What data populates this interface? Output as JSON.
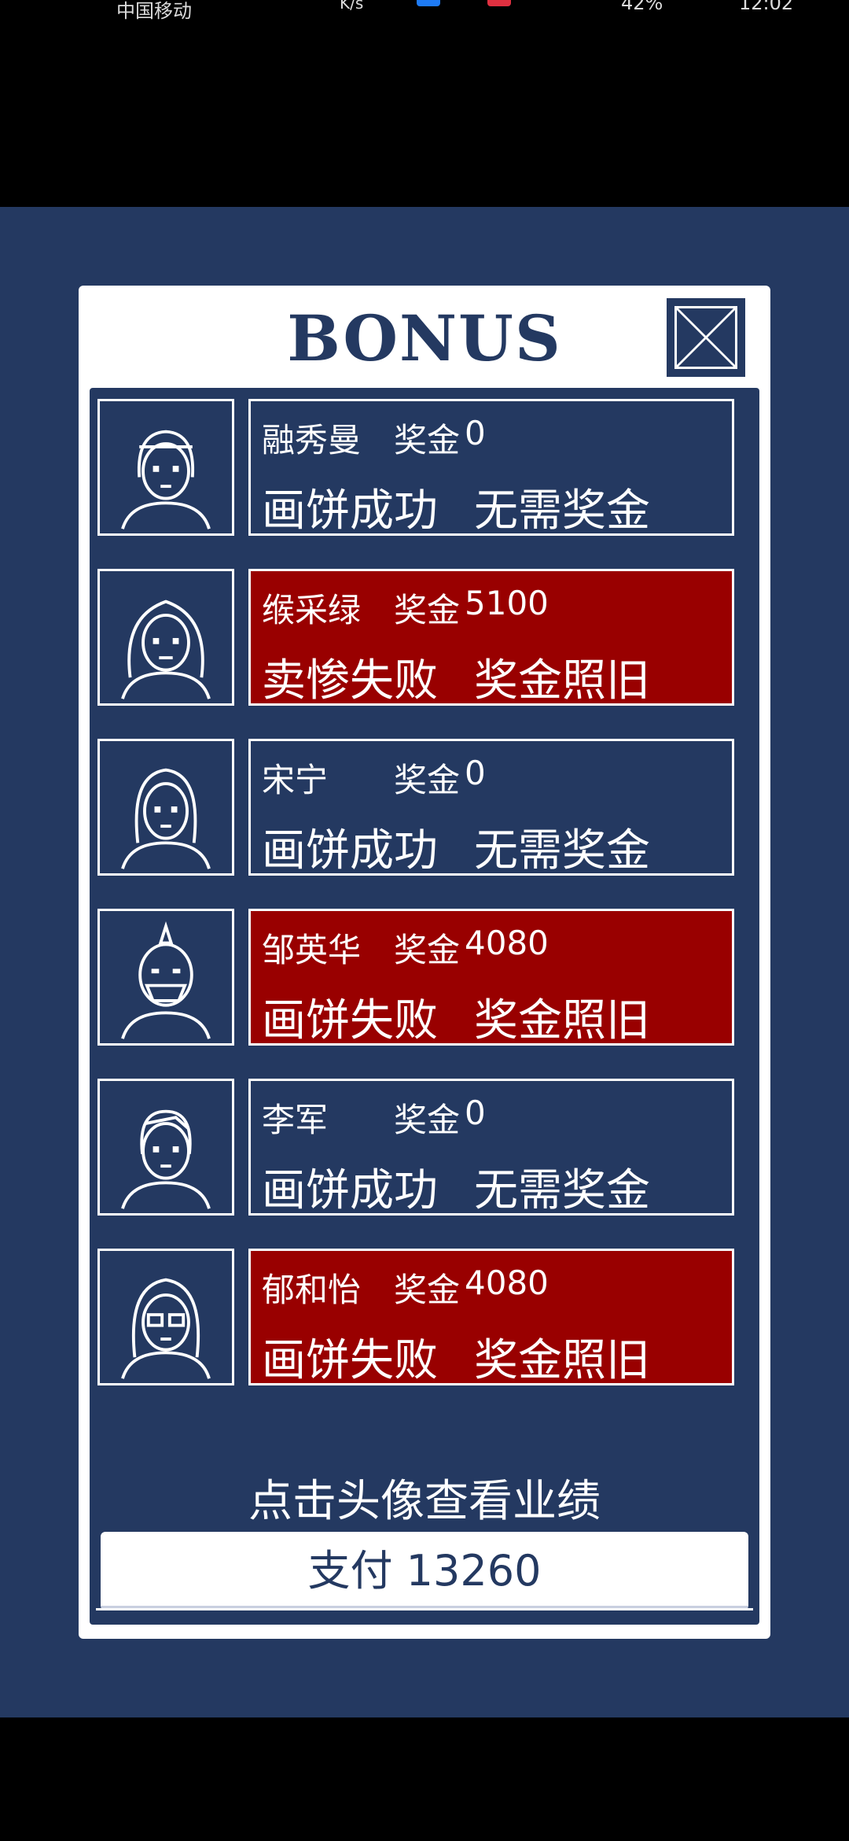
{
  "status_bar": {
    "carrier": "中国移动",
    "speed": "K/s",
    "battery": "42%",
    "time": "12:02"
  },
  "panel": {
    "title": "BONUS",
    "close_icon": "close-x-icon"
  },
  "bonus_label": "奖金",
  "employees": [
    {
      "name": "融秀曼",
      "bonus": "0",
      "result_left": "画饼成功",
      "result_right": "无需奖金",
      "status": "success"
    },
    {
      "name": "缑采绿",
      "bonus": "5100",
      "result_left": "卖惨失败",
      "result_right": "奖金照旧",
      "status": "fail"
    },
    {
      "name": "宋宁",
      "bonus": "0",
      "result_left": "画饼成功",
      "result_right": "无需奖金",
      "status": "success"
    },
    {
      "name": "邹英华",
      "bonus": "4080",
      "result_left": "画饼失败",
      "result_right": "奖金照旧",
      "status": "fail"
    },
    {
      "name": "李军",
      "bonus": "0",
      "result_left": "画饼成功",
      "result_right": "无需奖金",
      "status": "success"
    },
    {
      "name": "郁和怡",
      "bonus": "4080",
      "result_left": "画饼失败",
      "result_right": "奖金照旧",
      "status": "fail"
    }
  ],
  "hint": "点击头像查看业绩",
  "pay_button": "支付 13260",
  "colors": {
    "background": "#243961",
    "panel": "#ffffff",
    "fail": "#990000",
    "text": "#ffffff"
  }
}
